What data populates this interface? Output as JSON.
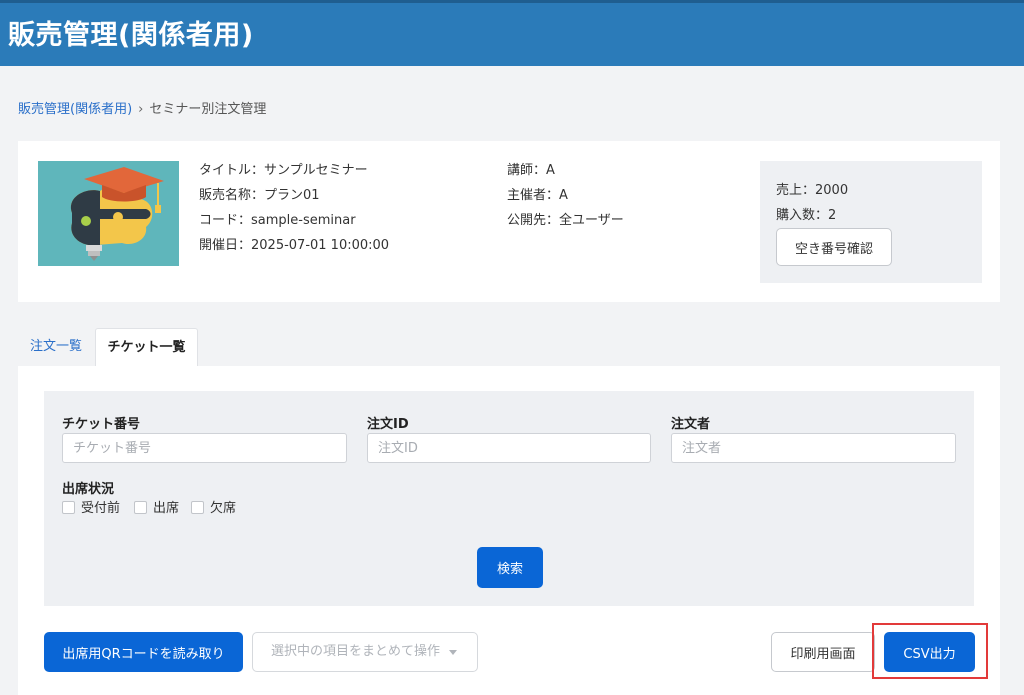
{
  "header": {
    "title": "販売管理(関係者用)"
  },
  "breadcrumb": {
    "parent": "販売管理(関係者用)",
    "separator": "›",
    "current": "セミナー別注文管理"
  },
  "info": {
    "title": "タイトル：サンプルセミナー",
    "sales_name": "販売名称：プラン01",
    "code": "コード：sample-seminar",
    "date": "開催日：2025-07-01 10:00:00",
    "lecturer": "講師：A",
    "organizer": "主催者：A",
    "visibility": "公開先：全ユーザー"
  },
  "stats": {
    "sales": "売上：2000",
    "purchases": "購入数：2",
    "vacancy_button": "空き番号確認"
  },
  "tabs": [
    {
      "label": "注文一覧",
      "active": false
    },
    {
      "label": "チケット一覧",
      "active": true
    }
  ],
  "filters": {
    "ticket_no": {
      "label": "チケット番号",
      "placeholder": "チケット番号",
      "value": ""
    },
    "order_id": {
      "label": "注文ID",
      "placeholder": "注文ID",
      "value": ""
    },
    "orderer": {
      "label": "注文者",
      "placeholder": "注文者",
      "value": ""
    },
    "attendance": {
      "label": "出席状況",
      "options": [
        "受付前",
        "出席",
        "欠席"
      ]
    },
    "search_button": "検索"
  },
  "actions": {
    "qr_button": "出席用QRコードを読み取り",
    "bulk_placeholder": "選択中の項目をまとめて操作",
    "print_button": "印刷用画面",
    "csv_button": "CSV出力"
  },
  "colors": {
    "header_bg": "#2b7bb9",
    "primary": "#0a66d6",
    "highlight": "#e23a3a"
  }
}
